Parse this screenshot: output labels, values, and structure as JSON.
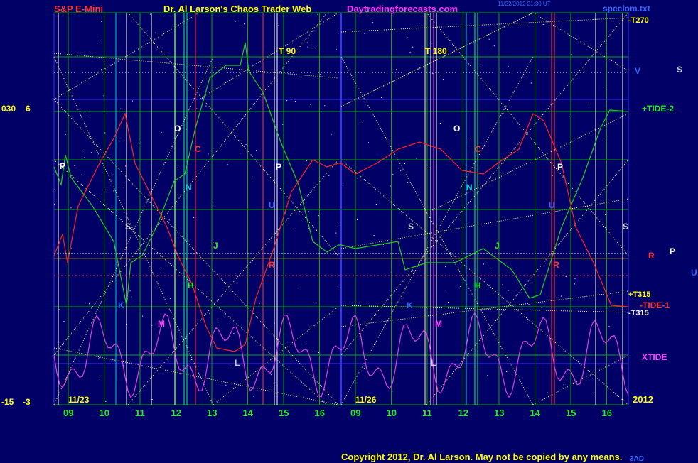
{
  "header": {
    "left_title": "S&P E-Mini",
    "center_title": "Dr. Al Larson's Chaos Trader Web",
    "site": "Daytradingforecasts.com",
    "timestamp": "11/22/2012 21:30 UT",
    "file": "spcclom.txt"
  },
  "footer": {
    "copyright": "Copyright 2012, Dr. Al Larson. May not be copied by any means.",
    "tag": "3AD"
  },
  "axis_left": {
    "top": [
      "030",
      "6"
    ],
    "bottom": [
      "-15",
      "-3"
    ]
  },
  "year_label": "2012",
  "dates": [
    "11/23",
    "11/26"
  ],
  "hours": [
    "09",
    "10",
    "11",
    "12",
    "13",
    "14",
    "15",
    "16",
    "09",
    "10",
    "11",
    "12",
    "13",
    "14",
    "15",
    "16"
  ],
  "right_labels": {
    "t270": "-T270",
    "v": "V",
    "s_far": "S",
    "tide2": "+TIDE-2",
    "r": "R",
    "p_far": "P",
    "u_far": "U",
    "t315_plus": "+T315",
    "tide1": "-TIDE-1",
    "t315_minus": "-T315",
    "xtide": "XTIDE"
  },
  "markers": {
    "t90": "T   90",
    "t180": "T   180",
    "letters": [
      "P",
      "O",
      "C",
      "N",
      "S",
      "J",
      "H",
      "M",
      "P",
      "U",
      "R",
      "K",
      "S",
      "O",
      "C",
      "N",
      "J",
      "H",
      "M",
      "P",
      "U",
      "R",
      "K",
      "S",
      "L",
      "L"
    ]
  },
  "colors": {
    "background": "#000066",
    "grid_green": "#00aa00",
    "planet_lines": "#ffff66",
    "blue_line": "#3333ff",
    "tide_green": "#22cc22",
    "tide_red": "#ff2222",
    "xtide_magenta": "#dd44dd",
    "white": "#ffffff",
    "header_red": "#ff3333",
    "header_yellow": "#ffff00",
    "header_magenta": "#ff33ff"
  },
  "chart_data": {
    "type": "line",
    "title": "S&P E-Mini",
    "x_categories": [
      "11/23 09",
      "10",
      "11",
      "12",
      "13",
      "14",
      "15",
      "16",
      "11/26 09",
      "10",
      "11",
      "12",
      "13",
      "14",
      "15",
      "16"
    ],
    "series": [
      {
        "name": "+TIDE-2",
        "color": "green",
        "values": [
          0.75,
          0.9,
          0.5,
          0.3,
          0.2,
          0.6,
          0.85,
          0.98,
          0.75,
          0.55,
          0.5,
          0.55,
          0.6,
          0.8,
          0.7,
          0.4,
          0.1,
          0.05,
          0.5,
          0.95
        ]
      },
      {
        "name": "-TIDE-1",
        "color": "red",
        "values": [
          0.1,
          0.3,
          0.6,
          0.85,
          0.6,
          0.4,
          0.15,
          0.05,
          0.3,
          0.7,
          0.9,
          0.85,
          0.9,
          0.8,
          0.75,
          0.85,
          0.95,
          0.7,
          0.3,
          0.15
        ]
      },
      {
        "name": "XTIDE",
        "color": "magenta",
        "values": [
          0.4,
          0.1,
          0.3,
          0.1,
          0.2,
          0.15,
          0.5,
          0.3,
          0.6,
          0.2,
          0.3,
          0.15,
          0.4,
          0.2,
          0.5,
          0.6,
          0.3,
          0.5,
          0.8,
          0.4
        ]
      }
    ]
  }
}
